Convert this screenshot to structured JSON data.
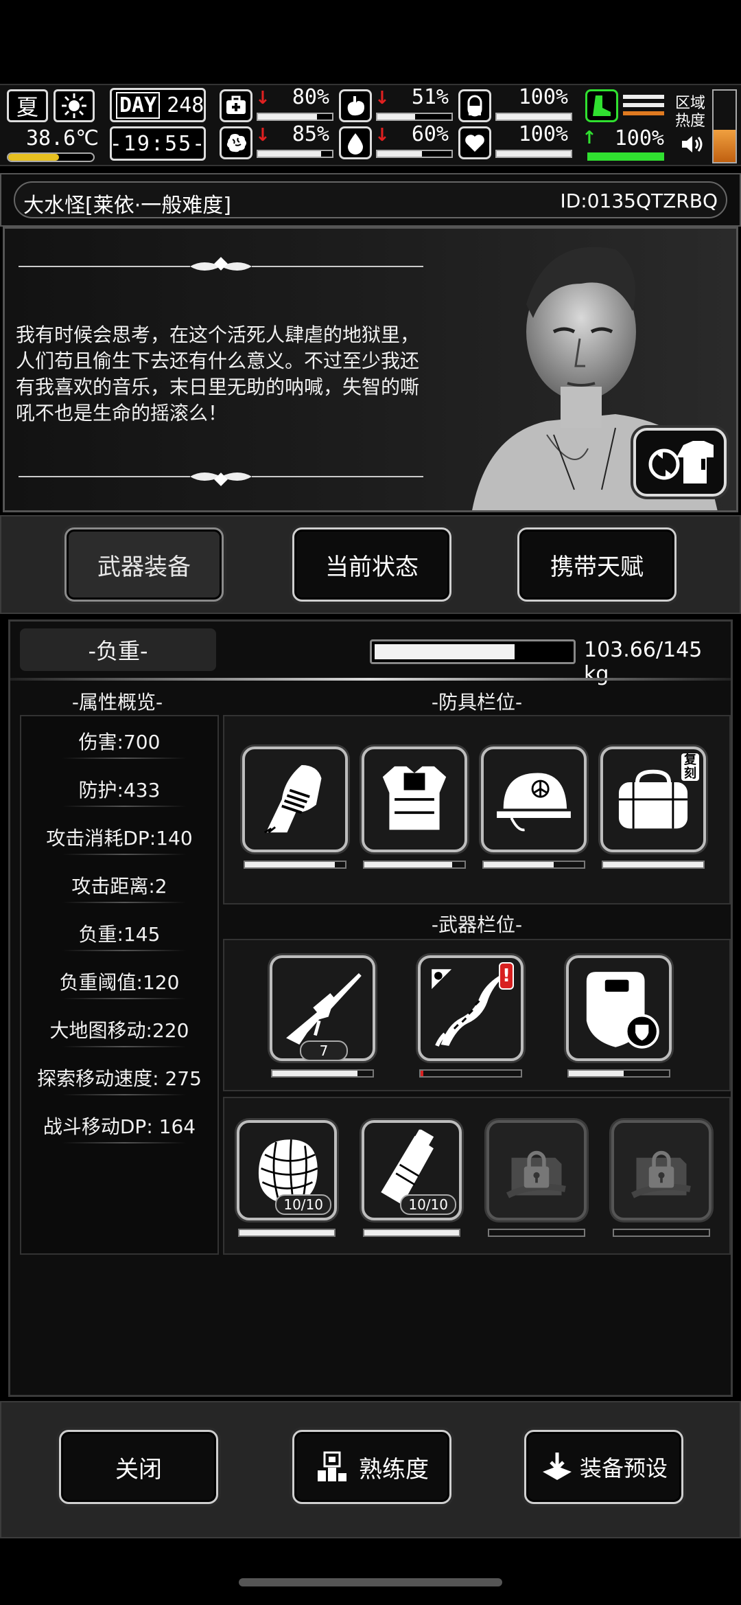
{
  "status": {
    "season": "夏",
    "weather_icon": "sun-icon",
    "temperature": "38.6℃",
    "day_label": "DAY",
    "day": "248",
    "clock": "-19:55-",
    "stats": [
      {
        "icon": "medkit-icon",
        "value": "80%",
        "trend": "down",
        "level": 0.8
      },
      {
        "icon": "stomach-icon",
        "value": "51%",
        "trend": "down",
        "level": 0.51
      },
      {
        "icon": "pill-icon",
        "value": "100%",
        "trend": "none",
        "level": 1.0
      },
      {
        "icon": "brain-icon",
        "value": "85%",
        "trend": "down",
        "level": 0.85
      },
      {
        "icon": "water-drop-icon",
        "value": "60%",
        "trend": "down",
        "level": 0.6
      },
      {
        "icon": "heart-icon",
        "value": "100%",
        "trend": "none",
        "level": 1.0
      }
    ],
    "stamina": {
      "icon": "boot-icon",
      "value": "100%",
      "trend": "up",
      "level": 1.0
    },
    "zone_heat_label": [
      "区域",
      "热度"
    ],
    "sound_icon": "speaker-icon"
  },
  "character": {
    "name": "大水怪[莱依·一般难度]",
    "id": "ID:0135QTZRBQ",
    "quote": "我有时候会思考，在这个活死人肆虐的地狱里，人们苟且偷生下去还有什么意义。不过至少我还有我喜欢的音乐，末日里无助的呐喊，失智的嘶吼不也是生命的摇滚么！"
  },
  "tabs": [
    "武器装备",
    "当前状态",
    "携带天赋"
  ],
  "load": {
    "label": "-负重-",
    "value": "103.66/145 kg",
    "ratio": 0.715
  },
  "attributes": {
    "title": "-属性概览-",
    "items": [
      "伤害:700",
      "防护:433",
      "攻击消耗DP:140",
      "攻击距离:2",
      "负重:145",
      "负重阈值:120",
      "大地图移动:220",
      "探索移动速度: 275",
      "战斗移动DP: 164"
    ]
  },
  "armor": {
    "title": "-防具栏位-",
    "slots": [
      {
        "icon": "gauntlet-icon",
        "durability": 0.9
      },
      {
        "icon": "body-armor-icon",
        "durability": 0.88
      },
      {
        "icon": "helmet-icon",
        "durability": 0.7
      },
      {
        "icon": "bag-icon",
        "durability": 1.0,
        "tag": "复刻"
      }
    ]
  },
  "weapons": {
    "title": "-武器栏位-",
    "slots": [
      {
        "icon": "sniper-rifle-icon",
        "durability": 0.85,
        "ammo": "7"
      },
      {
        "icon": "serrated-blade-icon",
        "durability": 0.03,
        "alert": "!"
      },
      {
        "icon": "riot-shield-icon",
        "durability": 0.55
      }
    ]
  },
  "items": {
    "slots": [
      {
        "icon": "net-icon",
        "durability": 1.0,
        "count": "10/10"
      },
      {
        "icon": "canister-icon",
        "durability": 1.0,
        "count": "10/10"
      },
      {
        "icon": "locked-slot-icon",
        "durability": 0
      },
      {
        "icon": "locked-slot-icon",
        "durability": 0
      }
    ]
  },
  "footer": {
    "close": "关闭",
    "proficiency": "熟练度",
    "preset": "装备预设"
  },
  "colors": {
    "background": "#000000",
    "panel": "#1b1b1b",
    "durability_low": "#d82020",
    "stamina": "#30e030",
    "heat": "#e07a20"
  }
}
